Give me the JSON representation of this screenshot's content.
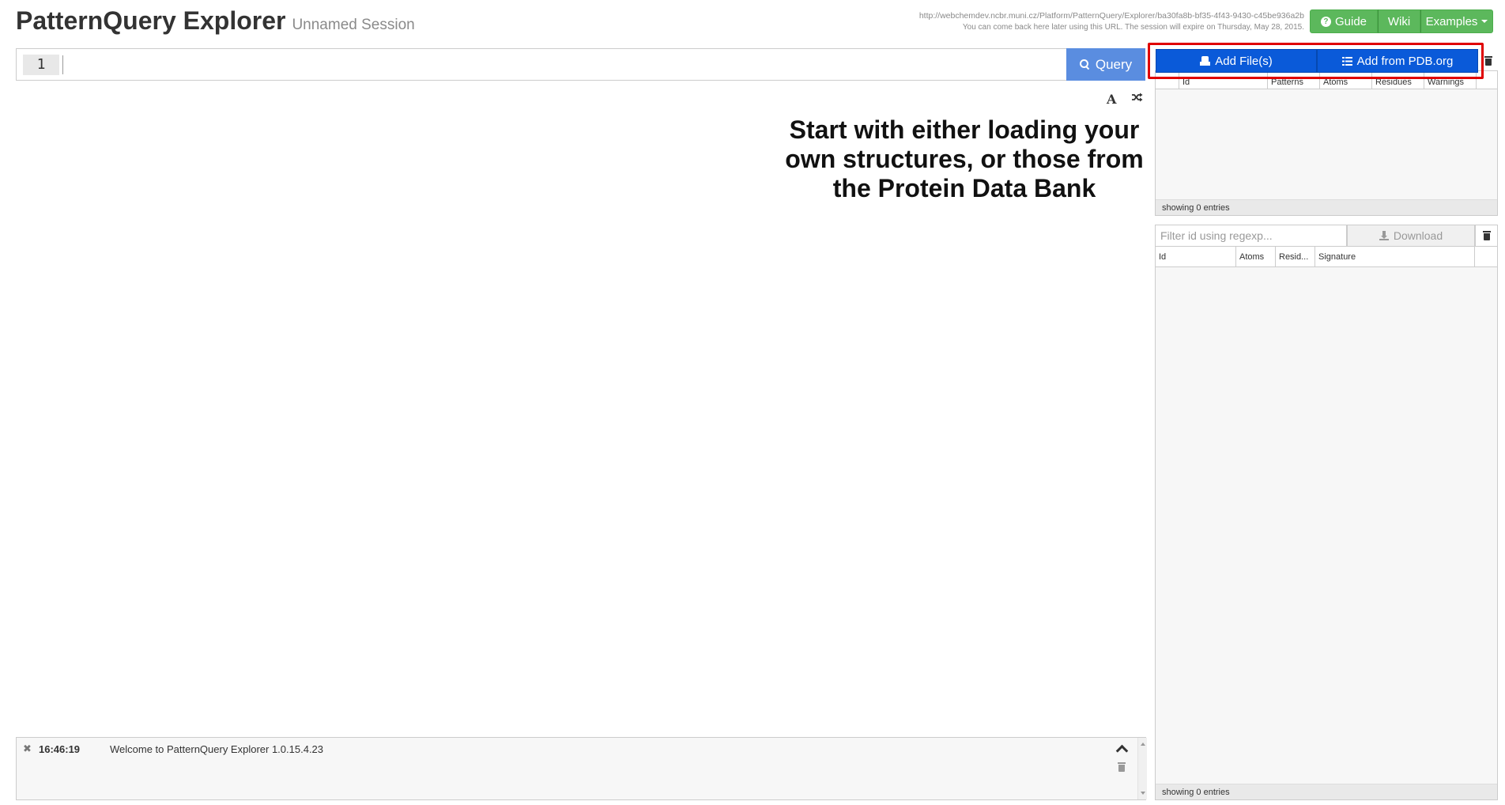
{
  "header": {
    "title": "PatternQuery Explorer",
    "session": "Unnamed Session",
    "url": "http://webchemdev.ncbr.muni.cz/Platform/PatternQuery/Explorer/ba30fa8b-bf35-4f43-9430-c45be936a2b",
    "note": "You can come back here later using this URL. The session will expire on Thursday, May 28, 2015.",
    "buttons": {
      "guide": "Guide",
      "wiki": "Wiki",
      "examples": "Examples"
    }
  },
  "editor": {
    "line_number": "1",
    "query_label": "Query"
  },
  "hint": {
    "line1": "Start with either loading your",
    "line2": "own structures, or those from",
    "line3": "the Protein Data Bank"
  },
  "log": {
    "time": "16:46:19",
    "message": "Welcome to PatternQuery Explorer 1.0.15.4.23"
  },
  "structures": {
    "add_files_label": "Add File(s)",
    "add_pdb_label": "Add from PDB.org",
    "columns": [
      "Id",
      "Patterns",
      "Atoms",
      "Residues",
      "Warnings"
    ],
    "footer": "showing 0 entries"
  },
  "patterns": {
    "filter_placeholder": "Filter id using regexp...",
    "download_label": "Download",
    "columns": [
      "Id",
      "Atoms",
      "Resid...",
      "Signature"
    ],
    "footer": "showing 0 entries"
  },
  "colors": {
    "header_green": "#5cb85c",
    "query_blue": "#5a8de0",
    "add_blue": "#0a5ad9",
    "highlight_red": "#e00000"
  },
  "icons": [
    "question-circle-icon",
    "caret-down-icon",
    "search-icon",
    "font-icon",
    "shuffle-icon",
    "close-icon",
    "chevron-up-icon",
    "trash-icon",
    "hdd-icon",
    "list-icon",
    "download-icon"
  ]
}
